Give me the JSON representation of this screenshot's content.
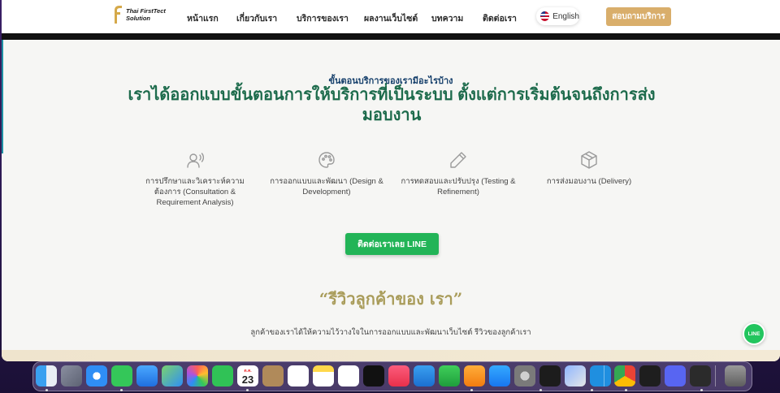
{
  "brand": {
    "line1": "Thai FirstTect",
    "line2": "Solution"
  },
  "nav": {
    "items": [
      "หน้าแรก",
      "เกี่ยวกับเรา",
      "บริการของเรา",
      "ผลงานเว็บไซต์",
      "บทความ",
      "ติดต่อเรา"
    ],
    "language": "English",
    "cta": "สอบถามบริการ"
  },
  "process": {
    "eyebrow": "ขั้นตอนบริการของเรามีอะไรบ้าง",
    "headline": "เราได้ออกแบบขั้นตอนการให้บริการที่เป็นระบบ ตั้งแต่การเริ่มต้นจนถึงการส่งมอบงาน",
    "steps": [
      {
        "icon": "consultation-icon",
        "label": "การปรึกษาและวิเคราะห์ความต้องการ (Consultation & Requirement Analysis)"
      },
      {
        "icon": "palette-icon",
        "label": "การออกแบบและพัฒนา (Design & Development)"
      },
      {
        "icon": "pencil-icon",
        "label": "การทดสอบและปรับปรุง (Testing & Refinement)"
      },
      {
        "icon": "package-icon",
        "label": "การส่งมอบงาน (Delivery)"
      }
    ],
    "line_button": "ติดต่อเราเลย LINE"
  },
  "reviews": {
    "title": "“รีวิวลูกค้าของ เรา”",
    "subtitle": "ลูกค้าของเราได้ให้ความไว้วางใจในการออกแบบและพัฒนาเว็บไซต์ รีวิวของลูกค้าเรา"
  },
  "line_float": "LINE",
  "dock": {
    "calendar_month": "ต.ค.",
    "calendar_day": "23",
    "apps": [
      "finder-icon",
      "launchpad-icon",
      "safari-icon",
      "messages-icon",
      "mail-icon",
      "maps-icon",
      "photos-icon",
      "facetime-icon",
      "calendar-icon",
      "contacts-icon",
      "reminders-icon",
      "notes-icon",
      "freeform-icon",
      "apple-tv-icon",
      "music-icon",
      "keynote-icon",
      "numbers-icon",
      "pages-icon",
      "app-store-icon",
      "system-settings-icon",
      "terminal-icon",
      "preview-icon",
      "vscode-icon",
      "chrome-icon",
      "figma-icon",
      "discord-icon",
      "console-icon",
      "trash-icon"
    ]
  }
}
